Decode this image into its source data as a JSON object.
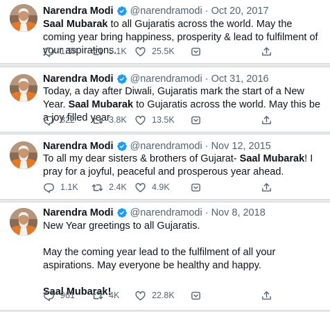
{
  "tweets": [
    {
      "name": "Narendra Modi",
      "handle": "@narendramodi",
      "separator": "·",
      "date": "Oct 20, 2017",
      "p1_a": "Saal Mubarak",
      "p1_b": " to all Gujaratis across the world. May the coming year bring happiness, prosperity & lead to fulfilment of your aspirations.",
      "replies": "1.5K",
      "retweets": "5.1K",
      "likes": "25.5K"
    },
    {
      "name": "Narendra Modi",
      "handle": "@narendramodi",
      "separator": "·",
      "date": "Oct 31, 2016",
      "p1_a": "Today, a day after Diwali, Gujaratis mark the start of a New Year. ",
      "p1_b": "Saal Mubarak",
      "p1_c": " to Gujaratis across the world. May this be a joy filled year",
      "replies": "822",
      "retweets": "3.8K",
      "likes": "13.5K"
    },
    {
      "name": "Narendra Modi",
      "handle": "@narendramodi",
      "separator": "·",
      "date": "Nov 12, 2015",
      "p1_a": "To all my dear sisters & brothers of Gujarat- ",
      "p1_b": "Saal Mubarak",
      "p1_c": "! I pray for a joyful, peaceful and prosperous year ahead.",
      "replies": "1.1K",
      "retweets": "2.4K",
      "likes": "4.9K"
    },
    {
      "name": "Narendra Modi",
      "handle": "@narendramodi",
      "separator": "·",
      "date": "Nov 8, 2018",
      "p1": "New Year greetings to all Gujaratis.",
      "p2": "May the coming year lead to the fulfilment of all your aspirations. May everyone be healthy and happy.",
      "p3": "Saal Mubarak!",
      "replies": "961",
      "retweets": "4K",
      "likes": "22.8K"
    }
  ],
  "icons": [
    "reply-icon",
    "retweet-icon",
    "like-icon",
    "bookmark-icon",
    "share-icon",
    "verified-badge-icon"
  ],
  "colors": {
    "text": "#0f1419",
    "secondary": "#536471",
    "verified": "#1d9bf0",
    "divider": "#cfd9de"
  }
}
